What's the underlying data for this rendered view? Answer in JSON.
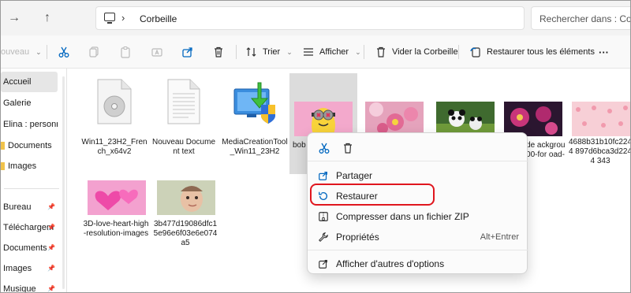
{
  "address": {
    "back_icon": "arrow-right-icon",
    "up_icon": "arrow-up-icon",
    "location_icon": "this-pc-icon",
    "path": "Corbeille",
    "search_placeholder": "Rechercher dans : Corbeille"
  },
  "toolbar": {
    "new_label": "ouveau",
    "sort_label": "Trier",
    "view_label": "Afficher",
    "empty_label": "Vider la Corbeille",
    "restore_all_label": "Restaurer tous les éléments",
    "more_label": "···"
  },
  "sidebar": {
    "items": [
      {
        "label": "Accueil",
        "pinned": false,
        "folder": false
      },
      {
        "label": "Galerie",
        "pinned": false,
        "folder": false
      },
      {
        "label": "Elina : personne",
        "pinned": false,
        "folder": false
      },
      {
        "label": "Documents",
        "pinned": false,
        "folder": true
      },
      {
        "label": "Images",
        "pinned": false,
        "folder": true
      },
      {
        "label": "Bureau",
        "pinned": true,
        "folder": false
      },
      {
        "label": "Téléchargem",
        "pinned": true,
        "folder": false
      },
      {
        "label": "Documents",
        "pinned": true,
        "folder": false
      },
      {
        "label": "Images",
        "pinned": true,
        "folder": false
      },
      {
        "label": "Musique",
        "pinned": true,
        "folder": false
      }
    ]
  },
  "files": [
    {
      "name": "Win11_23H2_French_x64v2",
      "icon": "disc-image-icon"
    },
    {
      "name": "Nouveau Document text",
      "icon": "text-document-icon"
    },
    {
      "name": "MediaCreationTool_Win11_23H2",
      "icon": "media-creation-tool-icon"
    },
    {
      "name": "bob cute p-w",
      "icon": "minion-photo"
    },
    {
      "name": "",
      "icon": "pink-flowers-photo"
    },
    {
      "name": "",
      "icon": "panda-photo"
    },
    {
      "name": "flower-de ackgroun 0x1200-for oad-2",
      "icon": "pink-flower-photo"
    },
    {
      "name": "4688b31b10fc2244 897d6bca3d2244 343",
      "icon": "pink-pattern-photo"
    },
    {
      "name": "3D-love-heart-high-resolution-images",
      "icon": "hearts-photo"
    },
    {
      "name": "3b477d19086dfc15e96e6f03e6e074a5",
      "icon": "baby-photo"
    }
  ],
  "context_menu": {
    "cut_icon": "scissors-icon",
    "delete_icon": "trash-icon",
    "items": [
      {
        "label": "Partager",
        "icon": "share-icon",
        "shortcut": ""
      },
      {
        "label": "Restaurer",
        "icon": "restore-icon",
        "shortcut": ""
      },
      {
        "label": "Compresser dans un fichier ZIP",
        "icon": "zip-icon",
        "shortcut": ""
      },
      {
        "label": "Propriétés",
        "icon": "wrench-icon",
        "shortcut": "Alt+Entrer"
      },
      {
        "label": "Afficher d'autres d'options",
        "icon": "more-options-icon",
        "shortcut": ""
      }
    ]
  },
  "colors": {
    "highlight": "#e0161e",
    "accent": "#0067c0",
    "folder": "#f0c24a"
  }
}
